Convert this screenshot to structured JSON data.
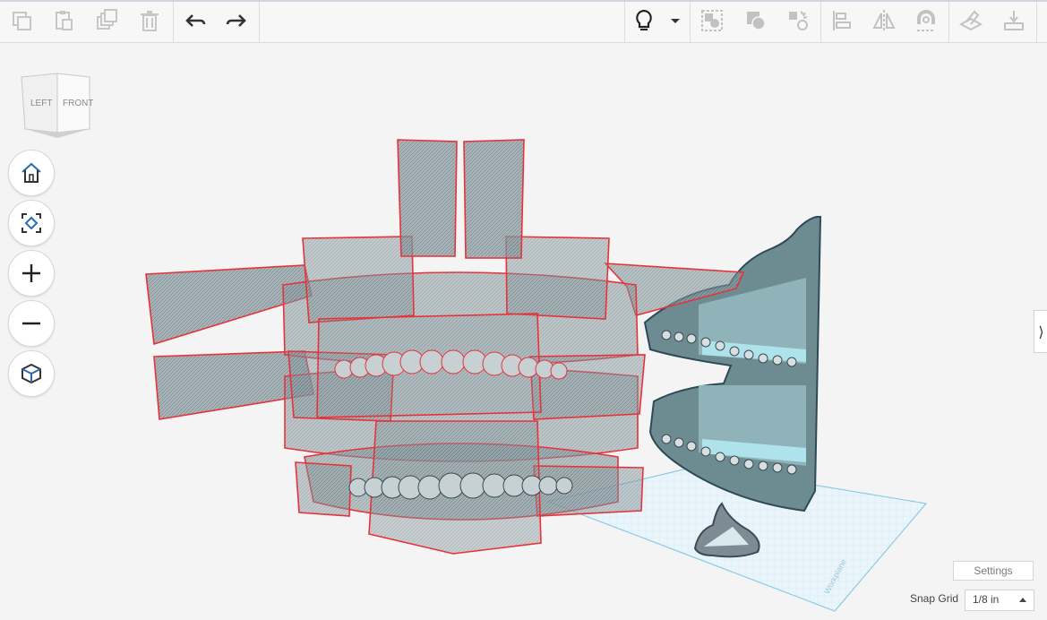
{
  "viewcube": {
    "left_face": "LEFT",
    "front_face": "FRONT"
  },
  "toolbar": {
    "left_buttons": [
      "copy-icon",
      "paste-icon",
      "duplicate-icon",
      "delete-icon",
      "undo-icon",
      "redo-icon"
    ],
    "right_buttons": [
      "lightbulb-icon",
      "dropdown-caret-icon",
      "group-icon",
      "solid-hole-icon",
      "ungroup-icon",
      "align-icon",
      "mirror-icon",
      "cruise-icon",
      "workplane-icon",
      "drop-icon"
    ]
  },
  "nav": [
    "home-icon",
    "fit-view-icon",
    "zoom-in-icon",
    "zoom-out-icon",
    "perspective-icon"
  ],
  "workplane": {
    "label": "Workplane"
  },
  "settings": {
    "label": "Settings"
  },
  "snap_grid": {
    "label": "Snap Grid",
    "value": "1/8 in"
  },
  "colors": {
    "selection": "#e8323a",
    "model": "#6f8f94",
    "workplane": "#9dd2e6",
    "accent": "#2b6cb0"
  }
}
